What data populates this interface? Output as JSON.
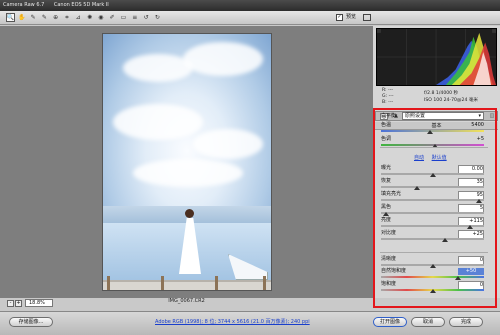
{
  "window": {
    "app_title": "Camera Raw 6.7",
    "camera": "Canon EOS 5D Mark II"
  },
  "toolbar": {
    "tools": [
      {
        "name": "zoom-tool",
        "icon": "magnifier-icon",
        "glyph": "🔍"
      },
      {
        "name": "hand-tool",
        "icon": "hand-icon",
        "glyph": "✋"
      },
      {
        "name": "white-balance-tool",
        "icon": "eyedropper-icon",
        "glyph": "✎"
      },
      {
        "name": "color-sampler-tool",
        "icon": "color-sampler-icon",
        "glyph": "✎"
      },
      {
        "name": "targeted-adjustment-tool",
        "icon": "target-icon",
        "glyph": "⊕"
      },
      {
        "name": "crop-tool",
        "icon": "crop-icon",
        "glyph": "⌗"
      },
      {
        "name": "straighten-tool",
        "icon": "straighten-icon",
        "glyph": "⊿"
      },
      {
        "name": "spot-removal-tool",
        "icon": "spot-removal-icon",
        "glyph": "✺"
      },
      {
        "name": "red-eye-tool",
        "icon": "red-eye-icon",
        "glyph": "◉"
      },
      {
        "name": "adjustment-brush-tool",
        "icon": "brush-icon",
        "glyph": "✐"
      },
      {
        "name": "graduated-filter-tool",
        "icon": "gradient-icon",
        "glyph": "▭"
      },
      {
        "name": "preferences-button",
        "icon": "list-icon",
        "glyph": "≡"
      },
      {
        "name": "rotate-ccw-button",
        "icon": "rotate-left-icon",
        "glyph": "↺"
      },
      {
        "name": "rotate-cw-button",
        "icon": "rotate-right-icon",
        "glyph": "↻"
      }
    ],
    "preview_label": "预览",
    "preview_checked": true
  },
  "image": {
    "filename": "IMG_0067.CR2"
  },
  "zoom": {
    "minus": "-",
    "plus": "+",
    "value": "18.8%"
  },
  "camera_info": {
    "r": "R:  ---",
    "g": "G:  ---",
    "b": "B:  ---",
    "exposure": "f/2.8   1/4000 秒",
    "iso_lens": "ISO 100   24-70@24 毫米"
  },
  "panel": {
    "tabs": [
      "◎",
      "▲",
      "◭",
      "▦",
      "▬",
      "◓",
      "fx",
      "◙",
      "≡",
      "◫"
    ],
    "active_tab": 0,
    "title": "基本",
    "white_balance_label": "白平衡:",
    "white_balance_value": "原照设置",
    "auto": "自动",
    "default": "默认值",
    "sliders": [
      {
        "label": "色温",
        "value": "5400",
        "pos": 0.48,
        "track": "temp"
      },
      {
        "label": "色调",
        "value": "+5",
        "pos": 0.52,
        "track": "tint"
      },
      {
        "label": "曝光",
        "value": "0.00",
        "pos": 0.5,
        "track": ""
      },
      {
        "label": "恢复",
        "value": "35",
        "pos": 0.35,
        "track": ""
      },
      {
        "label": "填充亮光",
        "value": "95",
        "pos": 0.95,
        "track": ""
      },
      {
        "label": "黑色",
        "value": "5",
        "pos": 0.05,
        "track": ""
      },
      {
        "label": "亮度",
        "value": "+115",
        "pos": 0.86,
        "track": ""
      },
      {
        "label": "对比度",
        "value": "+25",
        "pos": 0.62,
        "track": ""
      },
      {
        "label": "清晰度",
        "value": "0",
        "pos": 0.5,
        "track": ""
      },
      {
        "label": "自然饱和度",
        "value": "+50",
        "pos": 0.75,
        "track": "sat"
      },
      {
        "label": "饱和度",
        "value": "0",
        "pos": 0.5,
        "track": "sat"
      }
    ]
  },
  "bottom": {
    "save_image": "存储图像...",
    "workflow": "Adobe RGB (1998); 8 位; 3744 x 5616 (21.0 百万像素); 240 ppi",
    "open_image": "打开图像",
    "cancel": "取消",
    "done": "完成"
  },
  "colors": {
    "highlight_frame": "#e3161b",
    "link": "#1a3fcc"
  }
}
